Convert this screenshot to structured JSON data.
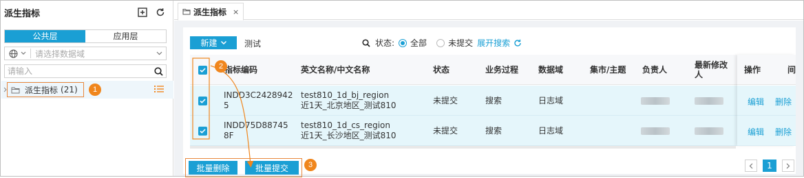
{
  "sidebar": {
    "title": "派生指标",
    "tabs": {
      "public": "公共层",
      "app": "应用层"
    },
    "domain_placeholder": "请选择数据域",
    "search_placeholder": "请输入",
    "tree_node": {
      "label": "派生指标",
      "count": "(21)"
    }
  },
  "tab": {
    "label": "派生指标",
    "close": "×"
  },
  "toolbar": {
    "new_label": "新建",
    "test_label": "测试",
    "status_label": "状态:",
    "radio_all": "全部",
    "radio_unsubmitted": "未提交",
    "expand_search": "展开搜索"
  },
  "table": {
    "headers": {
      "code": "指标编码",
      "name": "英文名称/中文名称",
      "status": "状态",
      "process": "业务过程",
      "domain": "数据域",
      "mart": "集市/主题",
      "owner": "负责人",
      "modified_l1": "最新修改",
      "modified_l2": "人",
      "ops": "操作",
      "extra": "间"
    },
    "rows": [
      {
        "code_l1": "INDD3C2428942",
        "code_l2": "5",
        "name_en": "test810_1d_bj_region",
        "name_cn": "近1天_北京地区_测试810",
        "status": "未提交",
        "process": "搜索",
        "domain": "日志域",
        "edit": "编辑",
        "delete": "删除"
      },
      {
        "code_l1": "INDD75D88745",
        "code_l2": "8F",
        "name_en": "test810_1d_cs_region",
        "name_cn": "近1天_长沙地区_测试810",
        "status": "未提交",
        "process": "搜索",
        "domain": "日志域",
        "edit": "编辑",
        "delete": "删除"
      }
    ]
  },
  "batch": {
    "delete": "批量删除",
    "submit": "批量提交"
  },
  "pager": {
    "current": "1"
  },
  "callouts": {
    "one": "1",
    "two": "2",
    "three": "3"
  },
  "colors": {
    "accent": "#1a9fd4",
    "callout": "#f0861d",
    "row_selected": "#e5f6fb"
  }
}
